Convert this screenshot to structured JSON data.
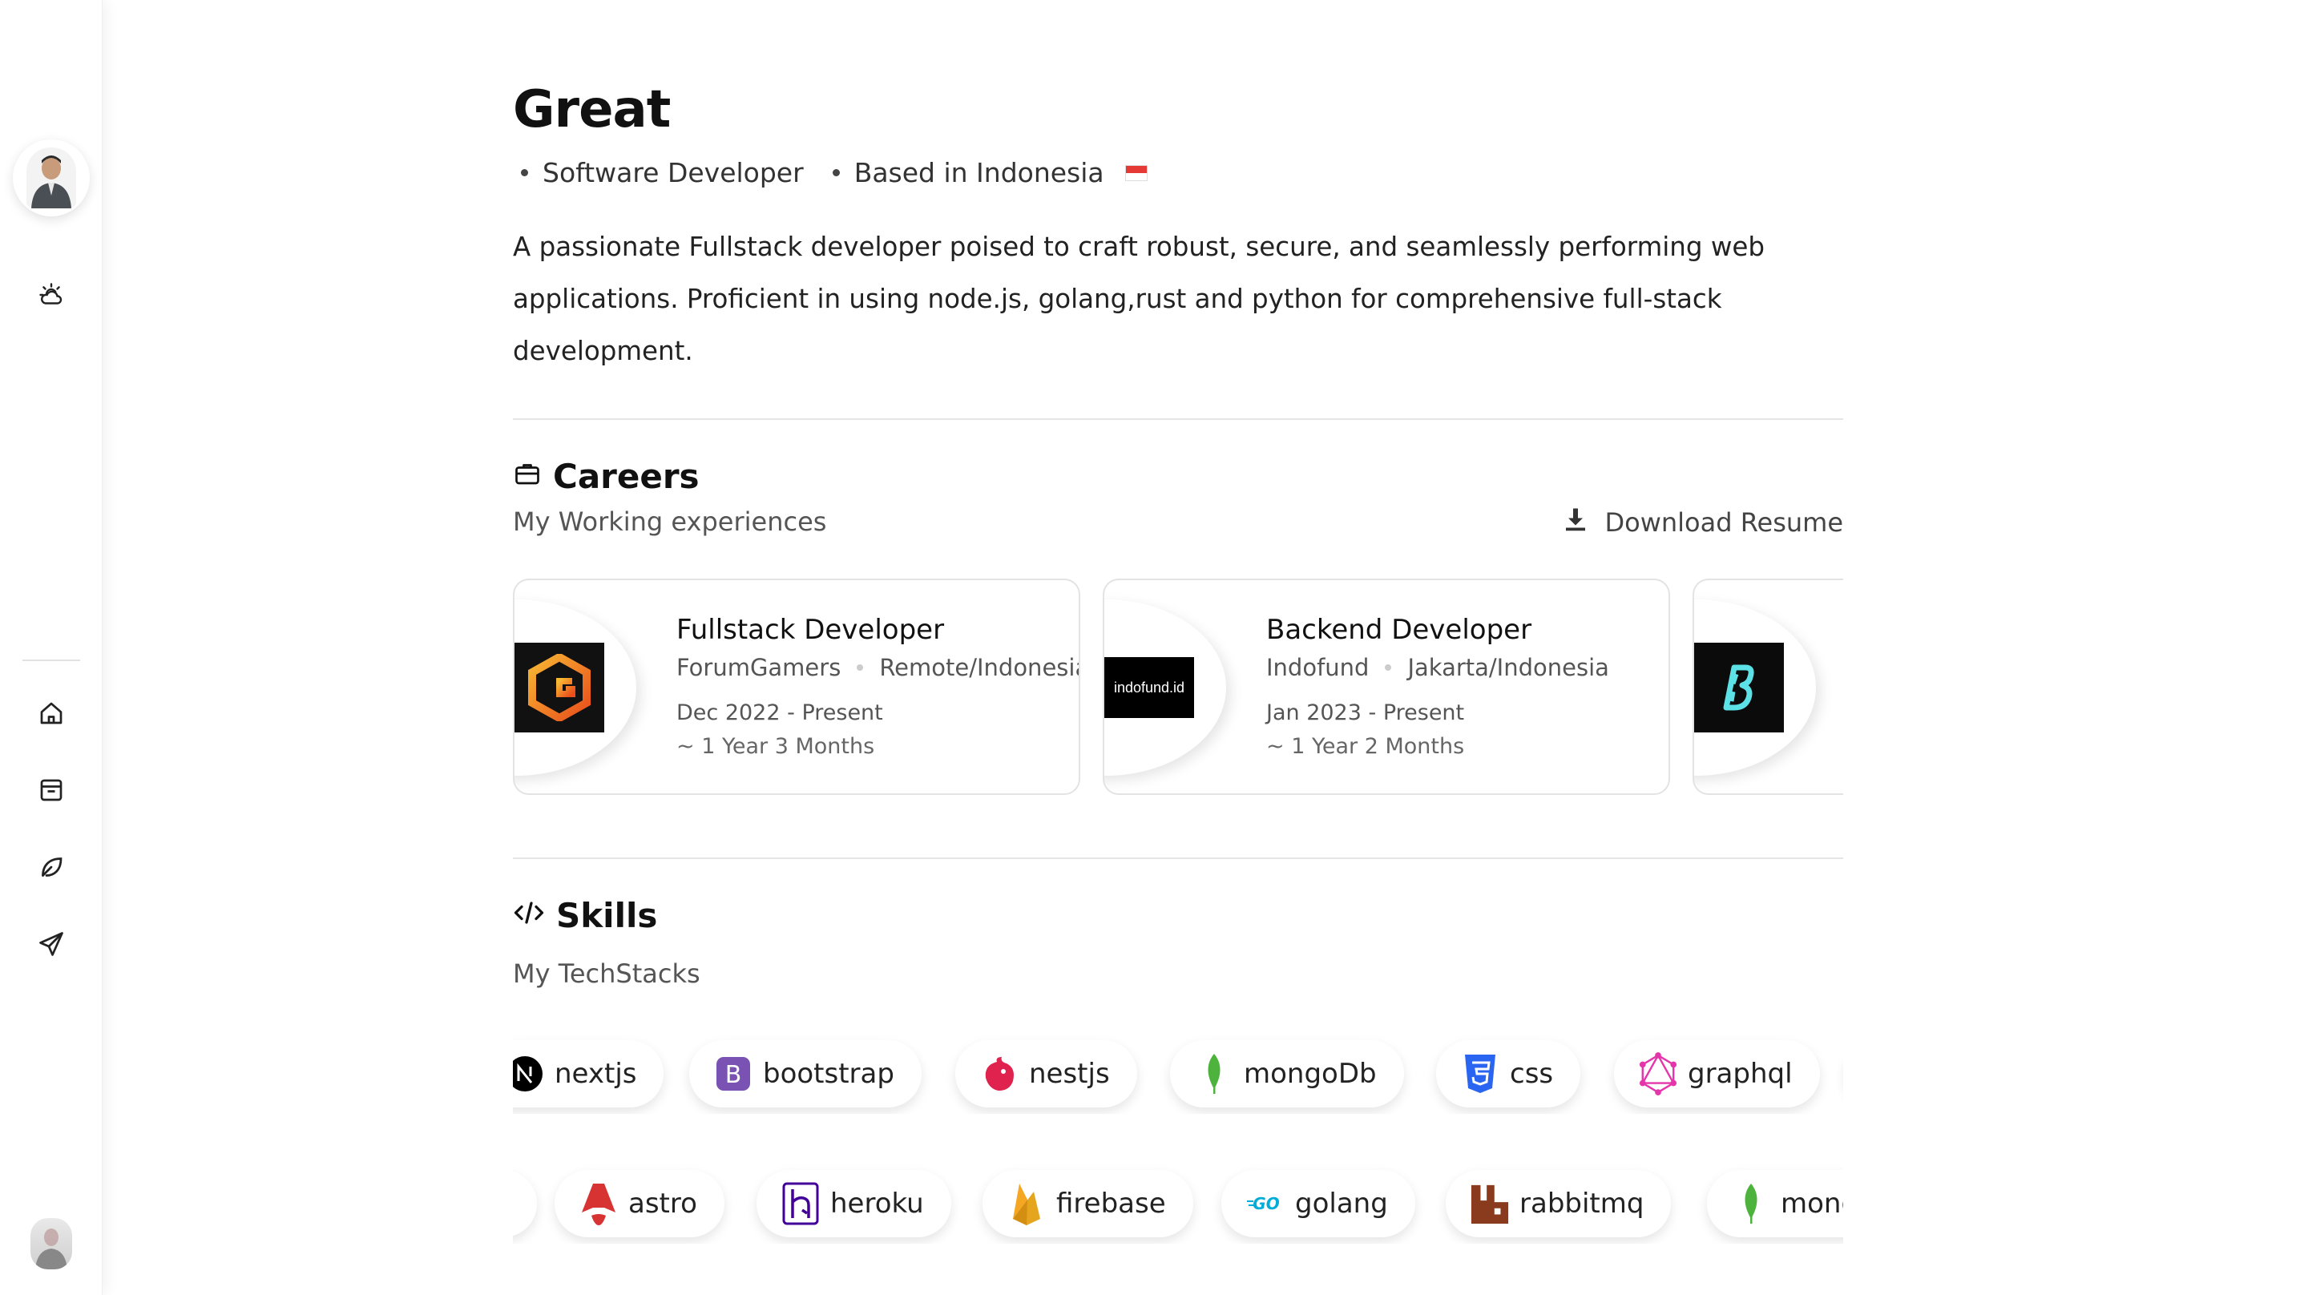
{
  "profile": {
    "name": "Great",
    "role": "Software Developer",
    "location": "Based in Indonesia",
    "bio": "A passionate Fullstack developer poised to craft robust, secure, and seamlessly performing web applications. Proficient in using node.js, golang,rust and python for comprehensive full-stack development."
  },
  "sidebar": {
    "icons": [
      "weather-icon",
      "home-icon",
      "archive-icon",
      "leaf-icon",
      "send-icon"
    ]
  },
  "careers": {
    "title": "Careers",
    "subtitle": "My Working experiences",
    "download_label": "Download Resume",
    "items": [
      {
        "role": "Fullstack Developer",
        "company": "ForumGamers",
        "location": "Remote/Indonesia",
        "date": "Dec 2022 - Present",
        "duration": "~ 1 Year 3 Months"
      },
      {
        "role": "Backend Developer",
        "company": "Indofund",
        "location": "Jakarta/Indonesia",
        "date": "Jan 2023 - Present",
        "duration": "~ 1 Year 2 Months",
        "logo_text": "indofund.id"
      }
    ]
  },
  "skills": {
    "title": "Skills",
    "subtitle": "My TechStacks",
    "row1": [
      "nextjs",
      "bootstrap",
      "nestjs",
      "mongoDb",
      "css",
      "graphql"
    ],
    "row2": [
      "astro",
      "heroku",
      "firebase",
      "golang",
      "rabbitmq",
      "mongoDb"
    ]
  },
  "colors": {
    "bootstrap": "#7952b3",
    "nestjs": "#e0234e",
    "mongodb": "#4db33d",
    "css": "#2965f1",
    "graphql": "#e535ab",
    "astro": "#d83333",
    "heroku": "#430098",
    "firebase": "#f5a623",
    "golang": "#00add8",
    "rabbitmq": "#8a3b1e",
    "bluesky": "#5ce1e6",
    "flag_red": "#e53935"
  }
}
